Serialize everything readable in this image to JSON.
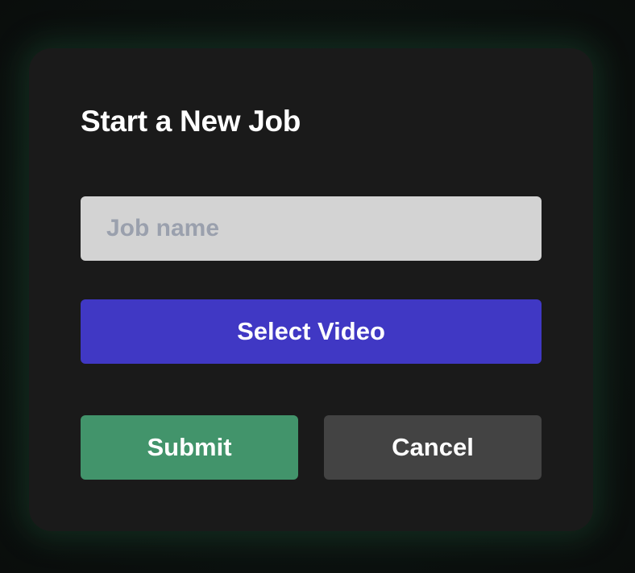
{
  "dialog": {
    "title": "Start a New Job",
    "job_name": {
      "value": "",
      "placeholder": "Job name"
    },
    "select_video_label": "Select Video",
    "submit_label": "Submit",
    "cancel_label": "Cancel"
  },
  "colors": {
    "dialog_background": "#1a1a1a",
    "input_background": "#d3d3d3",
    "select_video_button": "#4038c4",
    "submit_button": "#42946b",
    "cancel_button": "#434343",
    "glow": "#246e48"
  }
}
